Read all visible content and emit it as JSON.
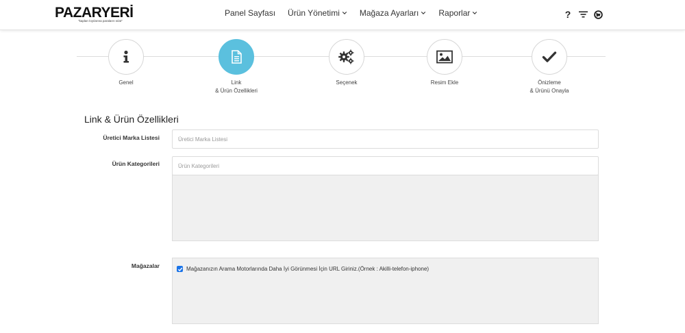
{
  "header": {
    "logo": "PAZARYERİ",
    "logo_tagline": "\"kapları kıyılarına paraların sılat\"",
    "nav": [
      {
        "label": "Panel Sayfası",
        "dropdown": false
      },
      {
        "label": "Ürün Yönetimi",
        "dropdown": true
      },
      {
        "label": "Mağaza Ayarları",
        "dropdown": true
      },
      {
        "label": "Raporlar",
        "dropdown": true
      }
    ],
    "icons": [
      "help-icon",
      "filter-icon",
      "globe-icon"
    ]
  },
  "stepper": {
    "active_index": 1,
    "accent_color": "#5bc0de",
    "steps": [
      {
        "line1": "Genel",
        "line2": "",
        "icon": "info-icon"
      },
      {
        "line1": "Link",
        "line2": "& Ürün Özellikleri",
        "icon": "document-icon"
      },
      {
        "line1": "Seçenek",
        "line2": "",
        "icon": "gears-icon"
      },
      {
        "line1": "Resim Ekle",
        "line2": "",
        "icon": "image-icon"
      },
      {
        "line1": "Önizleme",
        "line2": "& Ürünü Onayla",
        "icon": "checkmark-icon"
      }
    ]
  },
  "form": {
    "section_title": "Link & Ürün Özellikleri",
    "brand_list": {
      "label": "Üretici Marka Listesi",
      "placeholder": "Üretici Marka Listesi",
      "value": ""
    },
    "categories": {
      "label": "Ürün Kategorileri",
      "placeholder": "Ürün Kategorileri",
      "value": ""
    },
    "stores": {
      "label": "Mağazalar",
      "checkbox_checked": true,
      "checkbox_text": "Mağazanızın Arama Motorlarında Daha İyi Görünmesi İçin URL Giriniz.(Örnek : Akilli-telefon-iphone)"
    }
  }
}
